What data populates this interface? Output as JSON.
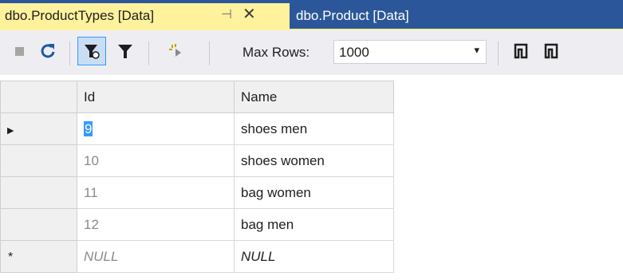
{
  "tabs": {
    "active": {
      "label": "dbo.ProductTypes [Data]",
      "pin": "⊣",
      "close": "✕"
    },
    "inactive": {
      "label": "dbo.Product [Data]"
    }
  },
  "toolbar": {
    "max_rows_label": "Max Rows:",
    "max_rows_value": "1000",
    "icons": [
      "stop-icon",
      "refresh-icon",
      "apply-filter-icon",
      "filter-icon",
      "run-icon",
      "script-icon",
      "script-file-icon"
    ]
  },
  "grid": {
    "columns": [
      "Id",
      "Name"
    ],
    "rows": [
      {
        "marker": "▶",
        "id": "9",
        "name": "shoes men"
      },
      {
        "marker": "",
        "id": "10",
        "name": "shoes women"
      },
      {
        "marker": "",
        "id": "11",
        "name": "bag women"
      },
      {
        "marker": "",
        "id": "12",
        "name": "bag men"
      }
    ],
    "new_row": {
      "marker": "*",
      "id": "NULL",
      "name": "NULL"
    }
  },
  "colors": {
    "tab_bar": "#2b579a",
    "active_tab": "#fff29d",
    "selection": "#3399ff"
  }
}
